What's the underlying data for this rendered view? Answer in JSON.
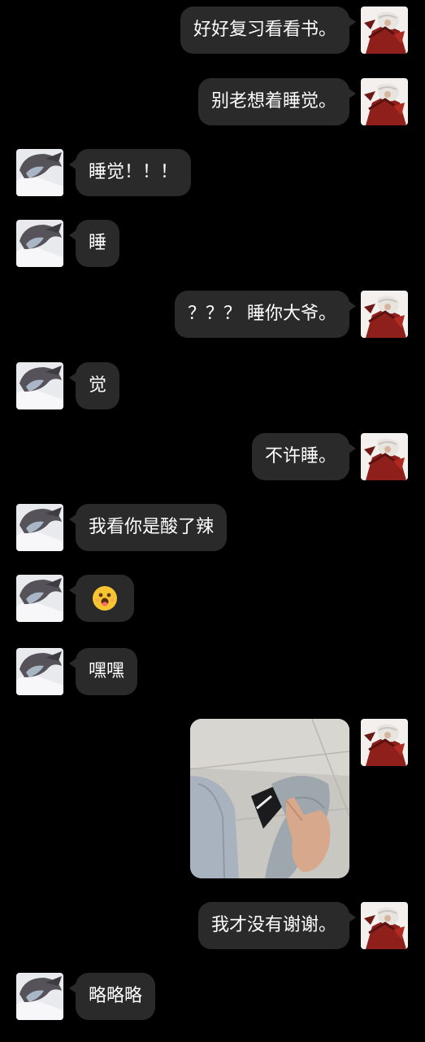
{
  "chat": {
    "messages": [
      {
        "side": "right",
        "text": "好好复习看看书。"
      },
      {
        "side": "right",
        "text": "别老想着睡觉。"
      },
      {
        "side": "left",
        "text": "睡觉！！！"
      },
      {
        "side": "left",
        "text": "睡"
      },
      {
        "side": "right",
        "text": "？？？ 睡你大爷。"
      },
      {
        "side": "left",
        "text": "觉"
      },
      {
        "side": "right",
        "text": "不许睡。"
      },
      {
        "side": "left",
        "text": "我看你是酸了辣"
      },
      {
        "side": "left",
        "type": "emoji",
        "icon": "tongue-out-emoji"
      },
      {
        "side": "left",
        "text": "嘿嘿"
      },
      {
        "side": "right",
        "type": "image",
        "description": "photo-message"
      },
      {
        "side": "right",
        "text": "我才没有谢谢。"
      },
      {
        "side": "left",
        "text": "略略略"
      }
    ]
  },
  "colors": {
    "background": "#000000",
    "bubble": "#2a2a2a",
    "text": "#ffffff"
  }
}
